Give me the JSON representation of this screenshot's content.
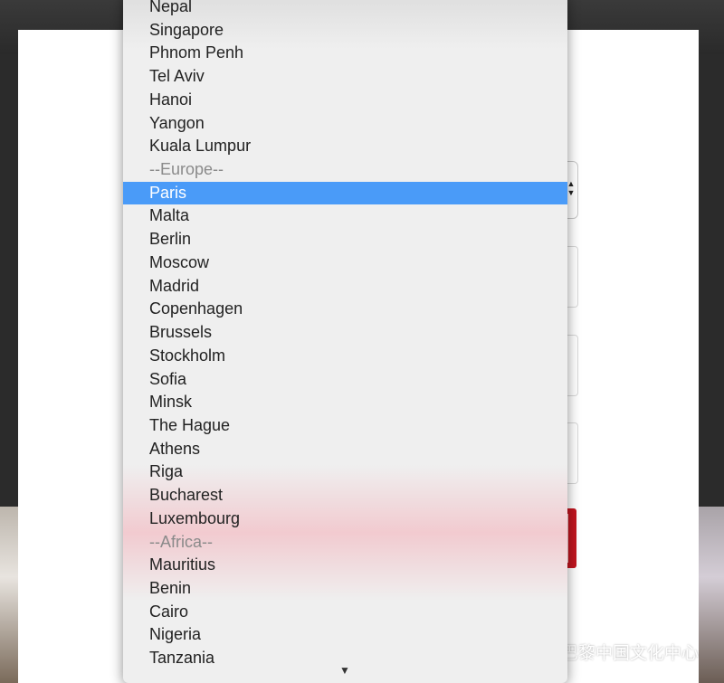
{
  "dropdown": {
    "options": [
      {
        "label": "Nepal",
        "kind": "option"
      },
      {
        "label": "Singapore",
        "kind": "option"
      },
      {
        "label": "Phnom Penh",
        "kind": "option"
      },
      {
        "label": "Tel Aviv",
        "kind": "option"
      },
      {
        "label": "Hanoi",
        "kind": "option"
      },
      {
        "label": "Yangon",
        "kind": "option"
      },
      {
        "label": "Kuala Lumpur",
        "kind": "option"
      },
      {
        "label": "--Europe--",
        "kind": "group"
      },
      {
        "label": "Paris",
        "kind": "selected"
      },
      {
        "label": "Malta",
        "kind": "option"
      },
      {
        "label": "Berlin",
        "kind": "option"
      },
      {
        "label": "Moscow",
        "kind": "option"
      },
      {
        "label": "Madrid",
        "kind": "option"
      },
      {
        "label": "Copenhagen",
        "kind": "option"
      },
      {
        "label": "Brussels",
        "kind": "option"
      },
      {
        "label": "Stockholm",
        "kind": "option"
      },
      {
        "label": "Sofia",
        "kind": "option"
      },
      {
        "label": "Minsk",
        "kind": "option"
      },
      {
        "label": "The Hague",
        "kind": "option"
      },
      {
        "label": "Athens",
        "kind": "option"
      },
      {
        "label": "Riga",
        "kind": "option"
      },
      {
        "label": "Bucharest",
        "kind": "option"
      },
      {
        "label": "Luxembourg",
        "kind": "option"
      },
      {
        "label": "--Africa--",
        "kind": "group"
      },
      {
        "label": "Mauritius",
        "kind": "option"
      },
      {
        "label": "Benin",
        "kind": "option"
      },
      {
        "label": "Cairo",
        "kind": "option"
      },
      {
        "label": "Nigeria",
        "kind": "option"
      },
      {
        "label": "Tanzania",
        "kind": "option"
      }
    ],
    "scroll_indicator_icon": "triangle-down-icon",
    "selected_color": "#4a9bf8"
  },
  "watermark": {
    "text": "巴黎中国文化中心",
    "icon": "wechat-icon"
  },
  "colors": {
    "submit_button": "#c2151f"
  }
}
